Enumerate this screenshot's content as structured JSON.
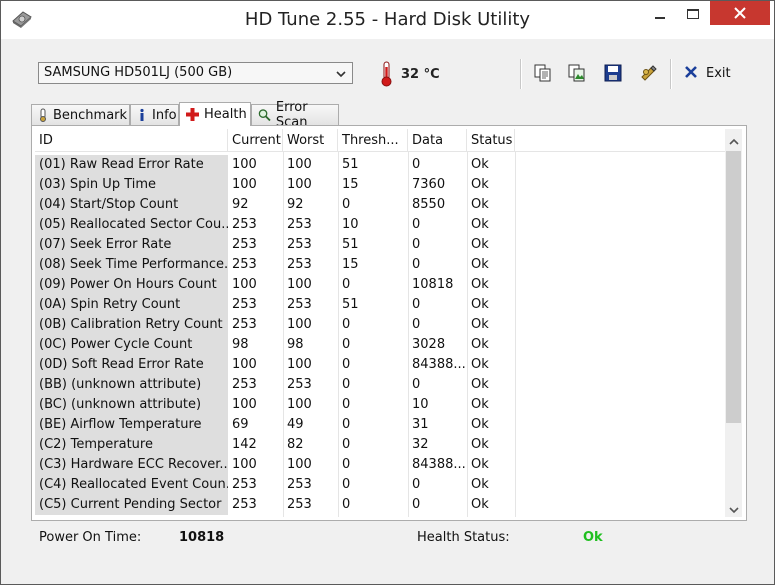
{
  "window": {
    "title": "HD Tune 2.55 - Hard Disk Utility"
  },
  "toolbar": {
    "drive": "SAMSUNG HD501LJ (500 GB)",
    "temperature": "32 °C",
    "icons": [
      "copy-text-icon",
      "copy-image-icon",
      "save-icon",
      "options-icon"
    ],
    "exit_label": "Exit"
  },
  "tabs": [
    {
      "label": "Benchmark",
      "icon": "benchmark-icon",
      "active": false
    },
    {
      "label": "Info",
      "icon": "info-icon",
      "active": false
    },
    {
      "label": "Health",
      "icon": "health-icon",
      "active": true
    },
    {
      "label": "Error Scan",
      "icon": "error-scan-icon",
      "active": false
    }
  ],
  "table": {
    "columns": [
      "ID",
      "Current",
      "Worst",
      "Thresh...",
      "Data",
      "Status"
    ],
    "rows": [
      [
        "(01) Raw Read Error Rate",
        "100",
        "100",
        "51",
        "0",
        "Ok"
      ],
      [
        "(03) Spin Up Time",
        "100",
        "100",
        "15",
        "7360",
        "Ok"
      ],
      [
        "(04) Start/Stop Count",
        "92",
        "92",
        "0",
        "8550",
        "Ok"
      ],
      [
        "(05) Reallocated Sector Cou...",
        "253",
        "253",
        "10",
        "0",
        "Ok"
      ],
      [
        "(07) Seek Error Rate",
        "253",
        "253",
        "51",
        "0",
        "Ok"
      ],
      [
        "(08) Seek Time Performance...",
        "253",
        "253",
        "15",
        "0",
        "Ok"
      ],
      [
        "(09) Power On Hours Count",
        "100",
        "100",
        "0",
        "10818",
        "Ok"
      ],
      [
        "(0A) Spin Retry Count",
        "253",
        "253",
        "51",
        "0",
        "Ok"
      ],
      [
        "(0B) Calibration Retry Count",
        "253",
        "100",
        "0",
        "0",
        "Ok"
      ],
      [
        "(0C) Power Cycle Count",
        "98",
        "98",
        "0",
        "3028",
        "Ok"
      ],
      [
        "(0D) Soft Read Error Rate",
        "100",
        "100",
        "0",
        "84388...",
        "Ok"
      ],
      [
        "(BB) (unknown attribute)",
        "253",
        "253",
        "0",
        "0",
        "Ok"
      ],
      [
        "(BC) (unknown attribute)",
        "100",
        "100",
        "0",
        "10",
        "Ok"
      ],
      [
        "(BE) Airflow Temperature",
        "69",
        "49",
        "0",
        "31",
        "Ok"
      ],
      [
        "(C2) Temperature",
        "142",
        "82",
        "0",
        "32",
        "Ok"
      ],
      [
        "(C3) Hardware ECC Recover...",
        "100",
        "100",
        "0",
        "84388...",
        "Ok"
      ],
      [
        "(C4) Reallocated Event Coun...",
        "253",
        "253",
        "0",
        "0",
        "Ok"
      ],
      [
        "(C5) Current Pending Sector",
        "253",
        "253",
        "0",
        "0",
        "Ok"
      ]
    ]
  },
  "footer": {
    "power_on_label": "Power On Time:",
    "power_on_value": "10818",
    "health_label": "Health Status:",
    "health_value": "Ok"
  },
  "colors": {
    "ok_green": "#1fbf1f",
    "close_red": "#c7372f",
    "id_column_bg": "#dedede"
  }
}
